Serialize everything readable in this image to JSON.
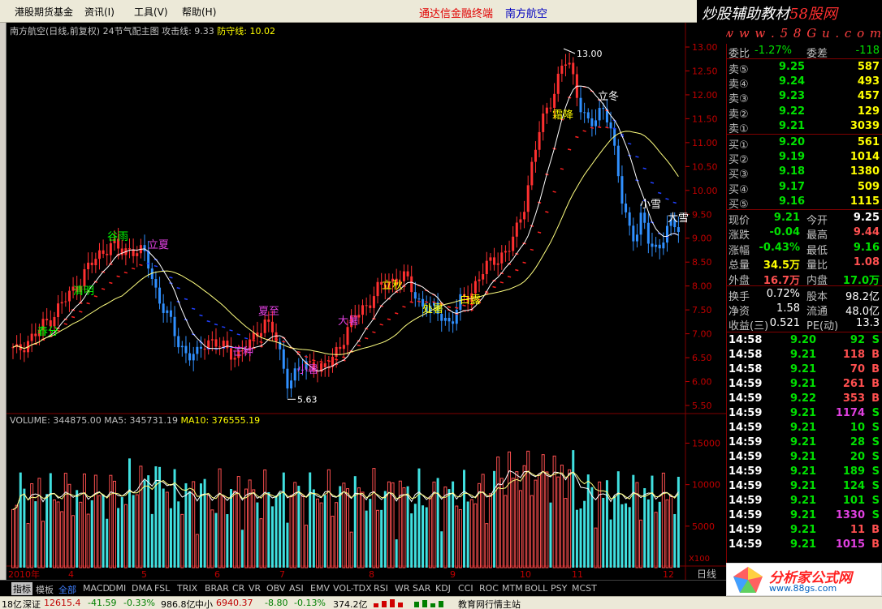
{
  "menu": {
    "items": [
      "港股期货基金",
      "资讯(I)",
      "工具(V)",
      "帮助(H)"
    ],
    "center_text": "通达信金融终端",
    "stock_name": "南方航空"
  },
  "logo_top": {
    "main_white": "炒股辅助教材",
    "main_red": "58股网",
    "sub": "★ w w w . 5 8 G u . c o m ★"
  },
  "chart": {
    "title": "南方航空(日线,前复权) 24节气配主图",
    "attack": "攻击线: 9.33",
    "defense": "防守线: 10.02",
    "price_axis": [
      "13.00",
      "12.50",
      "12.00",
      "11.50",
      "11.00",
      "10.50",
      "10.00",
      "9.50",
      "9.00",
      "8.50",
      "8.00",
      "7.50",
      "7.00",
      "6.50",
      "6.00",
      "5.50"
    ],
    "high_label": "13.00",
    "low_label": "5.63",
    "solar_terms": [
      {
        "text": "春分",
        "color": "#00ff00"
      },
      {
        "text": "清明",
        "color": "#00ff00"
      },
      {
        "text": "谷雨",
        "color": "#00ff00"
      },
      {
        "text": "立夏",
        "color": "#e040e0"
      },
      {
        "text": "芒种",
        "color": "#e040e0"
      },
      {
        "text": "夏至",
        "color": "#e040e0"
      },
      {
        "text": "小暑",
        "color": "#e040e0"
      },
      {
        "text": "大暑",
        "color": "#e040e0"
      },
      {
        "text": "立秋",
        "color": "#ffff00"
      },
      {
        "text": "处暑",
        "color": "#ffff00"
      },
      {
        "text": "白露",
        "color": "#ffff00"
      },
      {
        "text": "霜降",
        "color": "#ffff00"
      },
      {
        "text": "立冬",
        "color": "#ffffff"
      },
      {
        "text": "小雪",
        "color": "#ffffff"
      },
      {
        "text": "大雪",
        "color": "#ffffff"
      }
    ],
    "volume_title": "VOLUME: 344875.00",
    "ma5": "MA5: 345731.19",
    "ma10": "MA10: 376555.19",
    "volume_axis": [
      "15000",
      "10000",
      "5000"
    ],
    "volume_unit": "X100",
    "x_axis": [
      "2010年",
      "4",
      "5",
      "6",
      "7",
      "8",
      "9",
      "10",
      "11",
      "12"
    ],
    "period": "日线"
  },
  "quote": {
    "ratio_label": "委比",
    "ratio_value": "-1.27%",
    "diff_label": "委差",
    "diff_value": "-118",
    "asks": [
      {
        "label": "卖⑤",
        "price": "9.25",
        "vol": "587"
      },
      {
        "label": "卖④",
        "price": "9.24",
        "vol": "493"
      },
      {
        "label": "卖③",
        "price": "9.23",
        "vol": "457"
      },
      {
        "label": "卖②",
        "price": "9.22",
        "vol": "129"
      },
      {
        "label": "卖①",
        "price": "9.21",
        "vol": "3039"
      }
    ],
    "bids": [
      {
        "label": "买①",
        "price": "9.20",
        "vol": "561"
      },
      {
        "label": "买②",
        "price": "9.19",
        "vol": "1014"
      },
      {
        "label": "买③",
        "price": "9.18",
        "vol": "1380"
      },
      {
        "label": "买④",
        "price": "9.17",
        "vol": "509"
      },
      {
        "label": "买⑤",
        "price": "9.16",
        "vol": "1115"
      }
    ],
    "stats": [
      {
        "l1": "现价",
        "v1": "9.21",
        "c1": "green",
        "l2": "今开",
        "v2": "9.25",
        "c2": "white"
      },
      {
        "l1": "涨跌",
        "v1": "-0.04",
        "c1": "green",
        "l2": "最高",
        "v2": "9.44",
        "c2": "red"
      },
      {
        "l1": "涨幅",
        "v1": "-0.43%",
        "c1": "green",
        "l2": "最低",
        "v2": "9.16",
        "c2": "green"
      },
      {
        "l1": "总量",
        "v1": "34.5万",
        "c1": "yellow",
        "l2": "量比",
        "v2": "1.08",
        "c2": "red"
      },
      {
        "l1": "外盘",
        "v1": "16.7万",
        "c1": "red",
        "l2": "内盘",
        "v2": "17.0万",
        "c2": "green"
      }
    ],
    "stats2": [
      {
        "l1": "换手",
        "v1": "0.72%",
        "l2": "股本",
        "v2": "98.2亿"
      },
      {
        "l1": "净资",
        "v1": "1.58",
        "l2": "流通",
        "v2": "48.0亿"
      },
      {
        "l1": "收益(三)",
        "v1": "0.521",
        "l2": "PE(动)",
        "v2": "13.3"
      }
    ],
    "ticks": [
      {
        "time": "14:58",
        "price": "9.20",
        "vol": "92",
        "side": "S",
        "vc": "green"
      },
      {
        "time": "14:58",
        "price": "9.21",
        "vol": "118",
        "side": "B",
        "vc": "red"
      },
      {
        "time": "14:58",
        "price": "9.21",
        "vol": "70",
        "side": "B",
        "vc": "red"
      },
      {
        "time": "14:59",
        "price": "9.21",
        "vol": "261",
        "side": "B",
        "vc": "red"
      },
      {
        "time": "14:59",
        "price": "9.22",
        "vol": "353",
        "side": "B",
        "vc": "red"
      },
      {
        "time": "14:59",
        "price": "9.21",
        "vol": "1174",
        "side": "S",
        "vc": "purple"
      },
      {
        "time": "14:59",
        "price": "9.21",
        "vol": "10",
        "side": "S",
        "vc": "green"
      },
      {
        "time": "14:59",
        "price": "9.21",
        "vol": "28",
        "side": "S",
        "vc": "green"
      },
      {
        "time": "14:59",
        "price": "9.21",
        "vol": "20",
        "side": "S",
        "vc": "green"
      },
      {
        "time": "14:59",
        "price": "9.21",
        "vol": "189",
        "side": "S",
        "vc": "green"
      },
      {
        "time": "14:59",
        "price": "9.21",
        "vol": "124",
        "side": "S",
        "vc": "green"
      },
      {
        "time": "14:59",
        "price": "9.21",
        "vol": "101",
        "side": "S",
        "vc": "green"
      },
      {
        "time": "14:59",
        "price": "9.21",
        "vol": "1330",
        "side": "S",
        "vc": "purple"
      },
      {
        "time": "14:59",
        "price": "9.21",
        "vol": "11",
        "side": "B",
        "vc": "red"
      },
      {
        "time": "14:59",
        "price": "9.21",
        "vol": "1015",
        "side": "B",
        "vc": "purple"
      }
    ]
  },
  "tabs": [
    "指标",
    "模板",
    "全部",
    "MACD",
    "DMI",
    "DMA",
    "FSL",
    "TRIX",
    "BRAR",
    "CR",
    "VR",
    "OBV",
    "ASI",
    "EMV",
    "VOL-TDX",
    "RSI",
    "WR",
    "SAR",
    "KDJ",
    "CCI",
    "ROC",
    "MTM",
    "BOLL",
    "PSY",
    "MCST"
  ],
  "status": {
    "s1": "18亿",
    "sz_label": "深证",
    "sz_value": "12615.4",
    "sz_chg": "-41.59",
    "sz_pct": "-0.33%",
    "sz_amt": "986.8亿",
    "zx_label": "中小",
    "zx_value": "6940.37",
    "zx_chg": "-8.80",
    "zx_pct": "-0.13%",
    "zx_amt": "374.2亿",
    "right": "教育网行情主站"
  },
  "logo_bottom": {
    "line1": "分析家公式网",
    "line2": "www.88gs.com"
  }
}
